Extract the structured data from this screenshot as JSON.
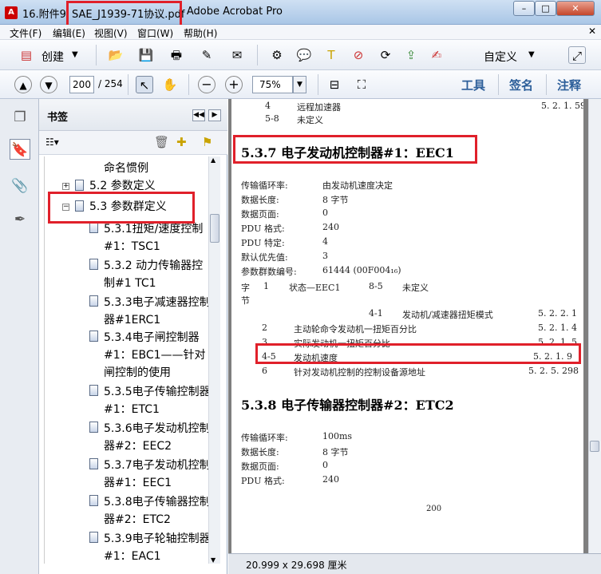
{
  "titlebar": {
    "tab1": "16.附件9",
    "doc_name": "SAE_J1939-71协议.pdf",
    "app_name": "- Adobe Acrobat Pro",
    "minimize": "–",
    "maximize": "□",
    "close": "✕"
  },
  "menu": [
    "文件(F)",
    "编辑(E)",
    "视图(V)",
    "窗口(W)",
    "帮助(H)"
  ],
  "toolbar": {
    "create_label": "创建",
    "customize_label": "自定义",
    "page_current": "200",
    "page_total": "/ 254",
    "zoom_value": "75%",
    "tools_label": "工具",
    "sign_label": "签名",
    "comment_label": "注释"
  },
  "sidebar": {
    "title": "书签",
    "items": [
      "命名惯例",
      "5.2 参数定义",
      "5.3 参数群定义",
      "5.3.1扭矩/速度控制#1：TSC1",
      "5.3.2 动力传输器控制#1 TC1",
      "5.3.3电子减速器控制器#1ERC1",
      "5.3.4电子闸控制器#1：EBC1——针对闸控制的使用",
      "5.3.5电子传输控制器#1：ETC1",
      "5.3.6电子发动机控制器#2：EEC2",
      "5.3.7电子发动机控制器#1：EEC1",
      "5.3.8电子传输器控制器#2：ETC2",
      "5.3.9电子轮轴控制器#1：EAC1"
    ]
  },
  "document": {
    "top_rows": [
      {
        "num": "4",
        "text": "远程加速器",
        "ref": "5. 2. 1. 59"
      },
      {
        "num": "5-8",
        "text": "未定义",
        "ref": ""
      }
    ],
    "heading1": "5.3.7 电子发动机控制器#1：EEC1",
    "fields1": [
      {
        "label": "传输循环率:",
        "value": "由发动机速度决定"
      },
      {
        "label": "数据长度:",
        "value": "8  字节"
      },
      {
        "label": "数据页面:",
        "value": "0"
      },
      {
        "label": "PDU 格式:",
        "value": "240"
      },
      {
        "label": "PDU 特定:",
        "value": "4"
      },
      {
        "label": "默认优先值:",
        "value": "3"
      },
      {
        "label": "参数群数编号:",
        "value": "61444 (00F004₁₆)"
      }
    ],
    "byte_header": {
      "c1": "字",
      "c2": "1",
      "c3": "状态—EEC1",
      "c4": "8-5",
      "c5": "未定义",
      "c6": "节"
    },
    "rows": [
      {
        "num": "4-1",
        "text": "发动机/减速器扭矩模式",
        "ref": "5. 2. 2. 1"
      },
      {
        "num": "2",
        "text": "主动轮命令发动机一扭矩百分比",
        "ref": "5. 2. 1. 4"
      },
      {
        "num": "3",
        "text": "实际发动机一扭矩百分比",
        "ref": "5. 2. 1. 5"
      },
      {
        "num": "4-5",
        "text": "发动机速度",
        "ref": "5. 2. 1. 9"
      },
      {
        "num": "6",
        "text": "针对发动机控制的控制设备源地址",
        "ref": "5. 2. 5. 298"
      }
    ],
    "heading2": "5.3.8 电子传输器控制器#2：ETC2",
    "fields2": [
      {
        "label": "传输循环率:",
        "value": "100ms"
      },
      {
        "label": "数据长度:",
        "value": "8  字节"
      },
      {
        "label": "数据页面:",
        "value": "0"
      },
      {
        "label": "PDU 格式:",
        "value": "240"
      }
    ],
    "page_number": "200"
  },
  "status": {
    "page_size": "20.999 x 29.698 厘米"
  }
}
